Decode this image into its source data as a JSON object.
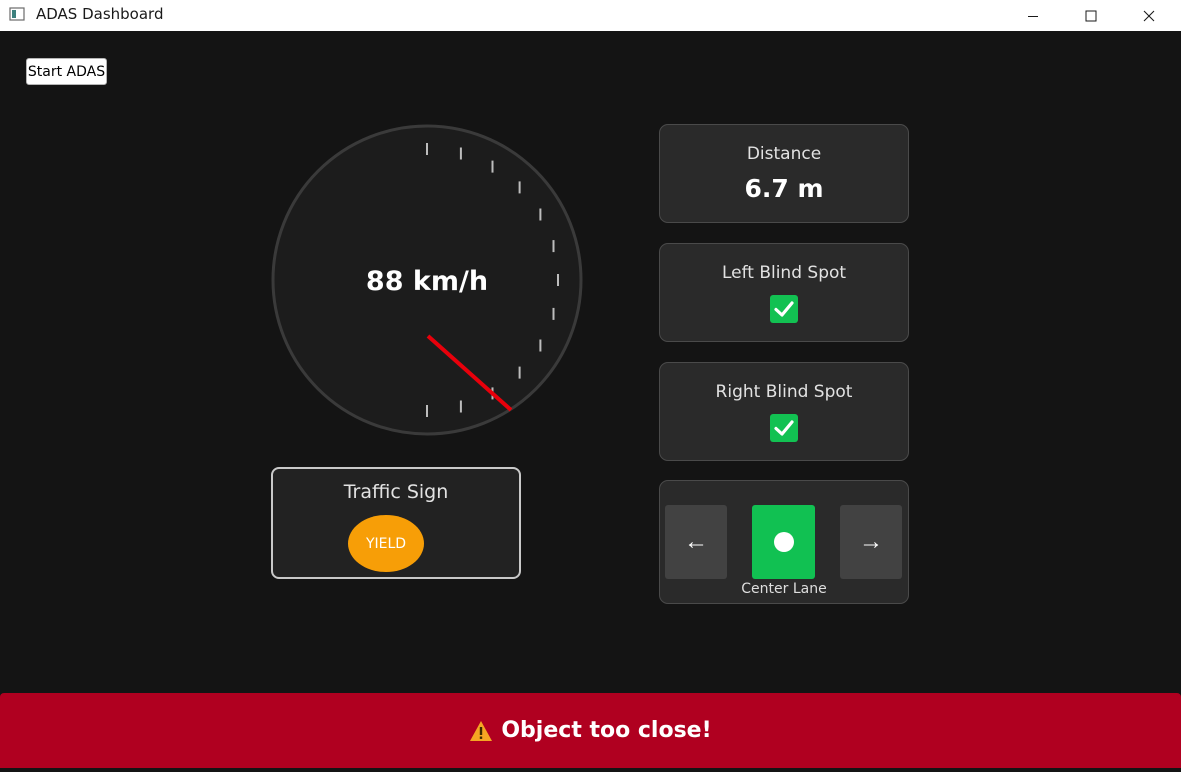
{
  "window": {
    "title": "ADAS Dashboard"
  },
  "controls": {
    "start_label": "Start ADAS"
  },
  "speedometer": {
    "speed_text": "88 km/h",
    "speed_value": 88,
    "needle_color": "#e8000b"
  },
  "distance": {
    "title": "Distance",
    "value": "6.7 m"
  },
  "left_blind_spot": {
    "title": "Left Blind Spot",
    "checked": true
  },
  "right_blind_spot": {
    "title": "Right Blind Spot",
    "checked": true
  },
  "traffic_sign": {
    "title": "Traffic Sign",
    "sign": "YIELD",
    "sign_color": "#f79e07"
  },
  "lane": {
    "left_arrow": "←",
    "right_arrow": "→",
    "label": "Center Lane",
    "active_color": "#11c152"
  },
  "alert": {
    "icon": "⚠",
    "message": "Object too close!",
    "color": "#b00020"
  }
}
